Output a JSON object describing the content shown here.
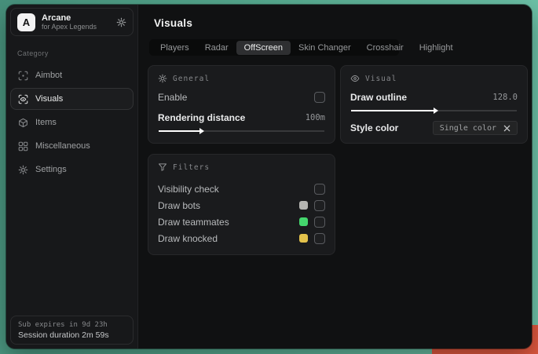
{
  "sidebar": {
    "logo_letter": "A",
    "app_name": "Arcane",
    "app_subtitle": "for Apex Legends",
    "category_label": "Category",
    "items": [
      {
        "label": "Aimbot",
        "active": false
      },
      {
        "label": "Visuals",
        "active": true
      },
      {
        "label": "Items",
        "active": false
      },
      {
        "label": "Miscellaneous",
        "active": false
      },
      {
        "label": "Settings",
        "active": false
      }
    ],
    "footer": {
      "sub_expires": "Sub expires in 9d 23h",
      "session_duration": "Session duration 2m 59s"
    }
  },
  "header": {
    "title": "Visuals"
  },
  "tabs": [
    {
      "label": "Players",
      "selected": false
    },
    {
      "label": "Radar",
      "selected": false
    },
    {
      "label": "OffScreen",
      "selected": true
    },
    {
      "label": "Skin Changer",
      "selected": false
    },
    {
      "label": "Crosshair",
      "selected": false
    },
    {
      "label": "Highlight",
      "selected": false
    }
  ],
  "panels": {
    "general": {
      "title": "General",
      "enable_label": "Enable",
      "enable_checked": false,
      "rendering_distance_label": "Rendering distance",
      "rendering_distance_value": "100m",
      "rendering_distance_fill_pct": "25%"
    },
    "filters": {
      "title": "Filters",
      "rows": [
        {
          "label": "Visibility check",
          "checked": false
        },
        {
          "label": "Draw bots",
          "swatch": "#b5b5b2",
          "checked": false
        },
        {
          "label": "Draw teammates",
          "swatch": "#44d66d",
          "checked": false
        },
        {
          "label": "Draw knocked",
          "swatch": "#e3c24b",
          "checked": false
        }
      ]
    },
    "visual": {
      "title": "Visual",
      "draw_outline_label": "Draw outline",
      "draw_outline_value": "128.0",
      "draw_outline_fill_pct": "50%",
      "style_color_label": "Style color",
      "style_color_value": "Single color"
    }
  },
  "colors": {
    "desktop_teal": "#57ab90",
    "desktop_red": "#e0583f",
    "accent_green": "#44d66d",
    "accent_yellow": "#e3c24b",
    "accent_gray": "#b5b5b2"
  }
}
